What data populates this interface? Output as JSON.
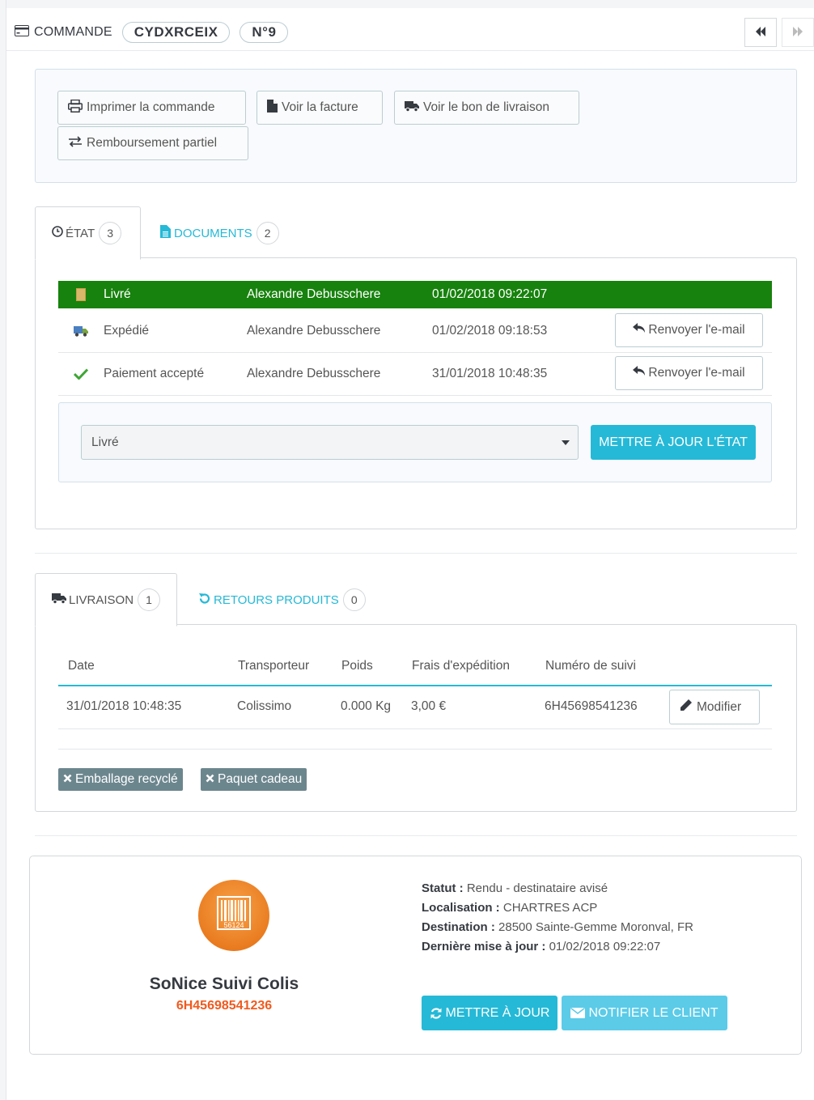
{
  "header": {
    "title": "COMMANDE",
    "reference": "CYDXRCEIX",
    "number": "N°9"
  },
  "actions": {
    "print": "Imprimer la commande",
    "invoice": "Voir la facture",
    "delivery_slip": "Voir le bon de livraison",
    "partial_refund": "Remboursement partiel"
  },
  "status_tabs": {
    "status_label": "ÉTAT",
    "status_count": "3",
    "documents_label": "DOCUMENTS",
    "documents_count": "2"
  },
  "history": [
    {
      "state": "Livré",
      "employee": "Alexandre Debusschere",
      "date": "01/02/2018 09:22:07",
      "current": true,
      "icon": "package-icon"
    },
    {
      "state": "Expédié",
      "employee": "Alexandre Debusschere",
      "date": "01/02/2018 09:18:53",
      "resend": "Renvoyer l'e-mail",
      "icon": "truck-icon"
    },
    {
      "state": "Paiement accepté",
      "employee": "Alexandre Debusschere",
      "date": "31/01/2018 10:48:35",
      "resend": "Renvoyer l'e-mail",
      "icon": "check-icon"
    }
  ],
  "status_update": {
    "selected": "Livré",
    "button": "METTRE À JOUR L'ÉTAT"
  },
  "shipping_tabs": {
    "shipping_label": "LIVRAISON",
    "shipping_count": "1",
    "returns_label": "RETOURS PRODUITS",
    "returns_count": "0"
  },
  "shipping_table": {
    "headers": [
      "Date",
      "Transporteur",
      "Poids",
      "Frais d'expédition",
      "Numéro de suivi"
    ],
    "row": {
      "date": "31/01/2018 10:48:35",
      "carrier": "Colissimo",
      "weight": "0.000 Kg",
      "cost": "3,00 €",
      "tracking": "6H45698541236",
      "edit": "Modifier"
    }
  },
  "tags": {
    "recycled": "Emballage recyclé",
    "gift": "Paquet cadeau"
  },
  "tracking": {
    "logo_number": "56124",
    "module_name": "SoNice Suivi Colis",
    "tracking_number": "6H45698541236",
    "status_label": "Statut :",
    "status_value": "Rendu - destinataire avisé",
    "location_label": "Localisation :",
    "location_value": "CHARTRES ACP",
    "destination_label": "Destination :",
    "destination_value": "28500 Sainte-Gemme Moronval, FR",
    "updated_label": "Dernière mise à jour :",
    "updated_value": "01/02/2018 09:22:07",
    "refresh_button": "METTRE À JOUR",
    "notify_button": "NOTIFIER LE CLIENT"
  },
  "colors": {
    "accent": "#25b9d7",
    "current_state": "#17820d",
    "tracking_number": "#f05a1e",
    "logo": "#f28c28"
  }
}
